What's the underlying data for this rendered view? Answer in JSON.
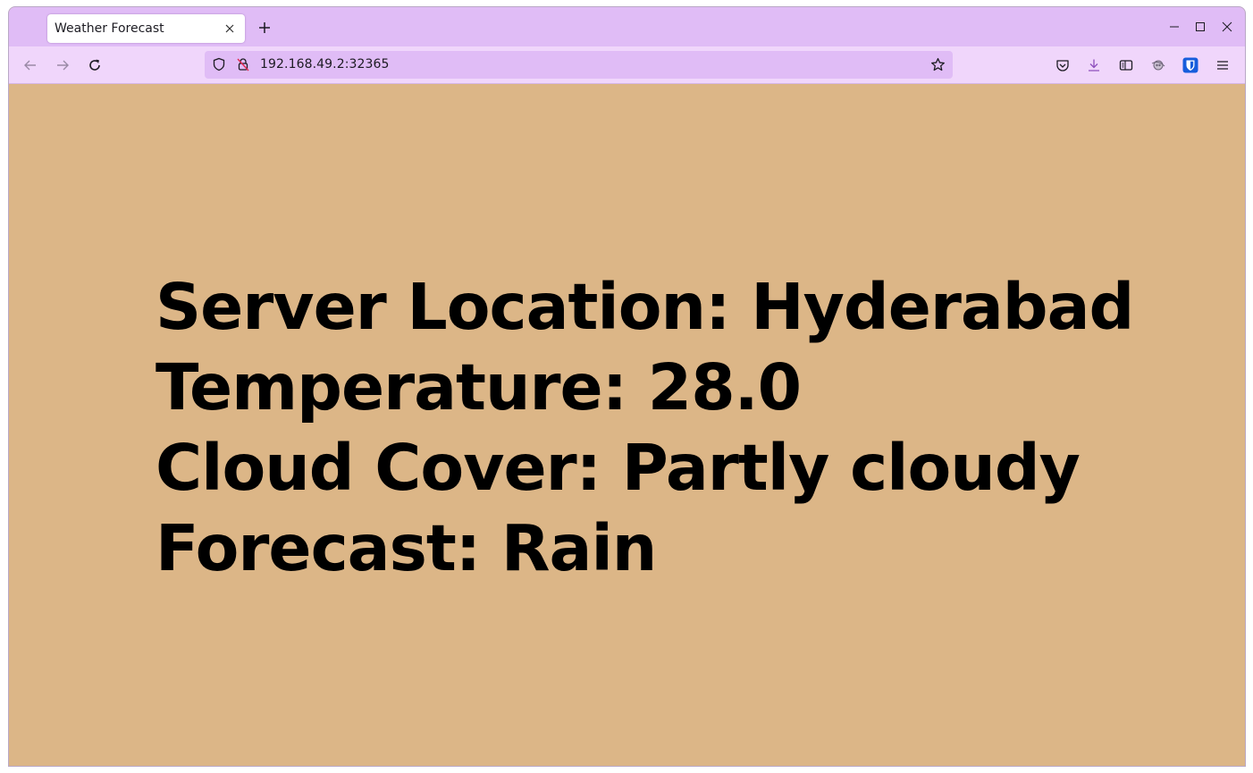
{
  "browser": {
    "tab": {
      "title": "Weather Forecast",
      "close_icon": "close-icon"
    },
    "new_tab_icon": "plus-icon",
    "window_controls": [
      "minimize-icon",
      "maximize-icon",
      "close-icon"
    ],
    "nav": {
      "back_icon": "arrow-left-icon",
      "forward_icon": "arrow-right-icon",
      "reload_icon": "reload-icon"
    },
    "url": "192.168.49.2:32365",
    "toolbar_icons": [
      "pocket-icon",
      "download-icon",
      "reader-view-icon",
      "extension-icon",
      "bitwarden-icon",
      "menu-icon"
    ],
    "colors": {
      "tabbar": "#e0bcf6",
      "navbar": "#f0d6fb",
      "urlbar": "#e0bcf6",
      "page_bg": "#dcb687",
      "bitwarden": "#175ddc",
      "download_accent": "#8e4fbd"
    }
  },
  "page": {
    "lines": [
      "Server Location: Hyderabad",
      "Temperature: 28.0",
      "Cloud Cover: Partly cloudy",
      "Forecast: Rain"
    ],
    "server_location": "Hyderabad",
    "temperature": "28.0",
    "cloud_cover": "Partly cloudy",
    "forecast": "Rain"
  }
}
